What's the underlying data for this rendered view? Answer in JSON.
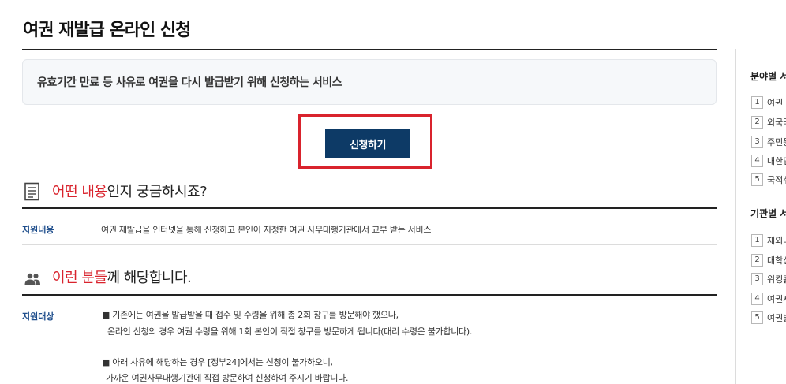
{
  "page": {
    "title": "여권 재발급 온라인 신청",
    "summary": "유효기간 만료 등 사유로 여권을 다시 발급받기 위해 신청하는 서비스",
    "apply_button": "신청하기"
  },
  "section_content": {
    "heading_accent": "어떤 내용",
    "heading_rest": "인지 궁금하시죠?",
    "icon": "document-icon",
    "row_label": "지원내용",
    "row_text": "여권 재발급을 인터넷을 통해 신청하고 본인이 지정한 여권 사무대행기관에서 교부 받는 서비스"
  },
  "section_target": {
    "heading_accent": "이런 분들",
    "heading_rest": "께 해당합니다.",
    "icon": "people-icon",
    "row_label": "지원대상",
    "lines": [
      "■ 기존에는 여권을 발급받을 때 접수 및 수령을 위해 총 2회 창구를 방문해야 했으나,",
      "온라인 신청의 경우 여권 수령을 위해 1회 본인이 직접 창구를 방문하게 됩니다(대리 수령은 불가합니다).",
      "■ 아래 사유에 해당하는 경우 [정부24]에서는 신청이 불가하오니,",
      "가까운 여권사무대행기관에 직접 방문하여 신청하여 주시기 바랍니다."
    ]
  },
  "sidebar": {
    "field_title": "분야별 서",
    "field_items": [
      {
        "num": "1",
        "label": "여권 재"
      },
      {
        "num": "2",
        "label": "외국국"
      },
      {
        "num": "3",
        "label": "주민등"
      },
      {
        "num": "4",
        "label": "대한민"
      },
      {
        "num": "5",
        "label": "국적취"
      }
    ],
    "agency_title": "기관별 서",
    "agency_items": [
      {
        "num": "1",
        "label": "재외국"
      },
      {
        "num": "2",
        "label": "대학신"
      },
      {
        "num": "3",
        "label": "워킹홀"
      },
      {
        "num": "4",
        "label": "여권재"
      },
      {
        "num": "5",
        "label": "여권발"
      }
    ]
  },
  "colors": {
    "accent_red": "#d9232d",
    "button_navy": "#0d3a66",
    "label_blue": "#1f4e8c"
  }
}
